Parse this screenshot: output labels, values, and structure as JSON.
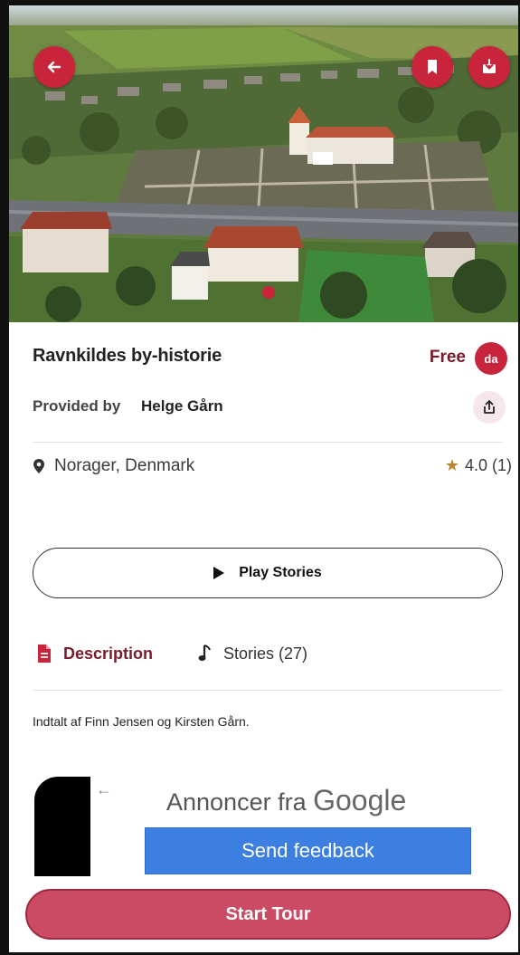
{
  "hero": {
    "back_icon": "arrow-left-icon",
    "bookmark_icon": "bookmark-icon",
    "download_icon": "download-icon"
  },
  "tour": {
    "title": "Ravnkildes by-historie",
    "price": "Free",
    "language_badge": "da",
    "provided_by_label": "Provided by",
    "provider_name": "Helge Gårn",
    "location": "Norager, Denmark",
    "rating_star": "★",
    "rating": "4.0 (1)"
  },
  "actions": {
    "play_stories_label": "Play Stories",
    "start_tour_label": "Start Tour"
  },
  "tabs": [
    {
      "label": "Description",
      "icon": "document-icon",
      "active": true
    },
    {
      "label": "Stories (27)",
      "icon": "music-note-icon",
      "active": false
    }
  ],
  "description": "Indtalt af Finn Jensen og Kirsten Gårn.",
  "ad": {
    "title_prefix": "Annoncer fra",
    "title_brand": "Google",
    "back_arrow": "←",
    "feedback_label": "Send feedback"
  },
  "colors": {
    "accent": "#c8243b",
    "accent_dark": "#7a1a2c",
    "start_button": "#cc4b64",
    "ad_button": "#3d7fe0"
  }
}
